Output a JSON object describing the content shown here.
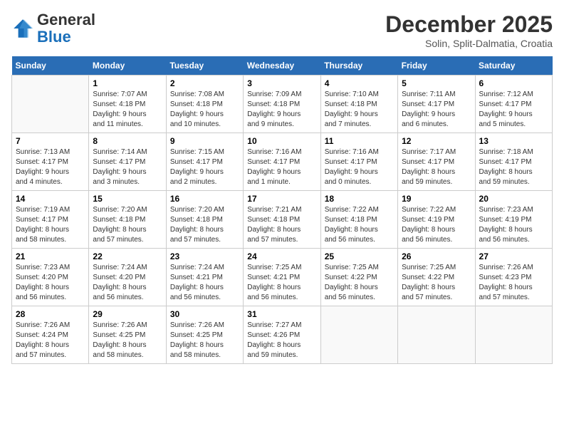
{
  "header": {
    "logo_general": "General",
    "logo_blue": "Blue",
    "title": "December 2025",
    "subtitle": "Solin, Split-Dalmatia, Croatia"
  },
  "days_of_week": [
    "Sunday",
    "Monday",
    "Tuesday",
    "Wednesday",
    "Thursday",
    "Friday",
    "Saturday"
  ],
  "weeks": [
    [
      {
        "day": "",
        "info": ""
      },
      {
        "day": "1",
        "info": "Sunrise: 7:07 AM\nSunset: 4:18 PM\nDaylight: 9 hours\nand 11 minutes."
      },
      {
        "day": "2",
        "info": "Sunrise: 7:08 AM\nSunset: 4:18 PM\nDaylight: 9 hours\nand 10 minutes."
      },
      {
        "day": "3",
        "info": "Sunrise: 7:09 AM\nSunset: 4:18 PM\nDaylight: 9 hours\nand 9 minutes."
      },
      {
        "day": "4",
        "info": "Sunrise: 7:10 AM\nSunset: 4:18 PM\nDaylight: 9 hours\nand 7 minutes."
      },
      {
        "day": "5",
        "info": "Sunrise: 7:11 AM\nSunset: 4:17 PM\nDaylight: 9 hours\nand 6 minutes."
      },
      {
        "day": "6",
        "info": "Sunrise: 7:12 AM\nSunset: 4:17 PM\nDaylight: 9 hours\nand 5 minutes."
      }
    ],
    [
      {
        "day": "7",
        "info": "Sunrise: 7:13 AM\nSunset: 4:17 PM\nDaylight: 9 hours\nand 4 minutes."
      },
      {
        "day": "8",
        "info": "Sunrise: 7:14 AM\nSunset: 4:17 PM\nDaylight: 9 hours\nand 3 minutes."
      },
      {
        "day": "9",
        "info": "Sunrise: 7:15 AM\nSunset: 4:17 PM\nDaylight: 9 hours\nand 2 minutes."
      },
      {
        "day": "10",
        "info": "Sunrise: 7:16 AM\nSunset: 4:17 PM\nDaylight: 9 hours\nand 1 minute."
      },
      {
        "day": "11",
        "info": "Sunrise: 7:16 AM\nSunset: 4:17 PM\nDaylight: 9 hours\nand 0 minutes."
      },
      {
        "day": "12",
        "info": "Sunrise: 7:17 AM\nSunset: 4:17 PM\nDaylight: 8 hours\nand 59 minutes."
      },
      {
        "day": "13",
        "info": "Sunrise: 7:18 AM\nSunset: 4:17 PM\nDaylight: 8 hours\nand 59 minutes."
      }
    ],
    [
      {
        "day": "14",
        "info": "Sunrise: 7:19 AM\nSunset: 4:17 PM\nDaylight: 8 hours\nand 58 minutes."
      },
      {
        "day": "15",
        "info": "Sunrise: 7:20 AM\nSunset: 4:18 PM\nDaylight: 8 hours\nand 57 minutes."
      },
      {
        "day": "16",
        "info": "Sunrise: 7:20 AM\nSunset: 4:18 PM\nDaylight: 8 hours\nand 57 minutes."
      },
      {
        "day": "17",
        "info": "Sunrise: 7:21 AM\nSunset: 4:18 PM\nDaylight: 8 hours\nand 57 minutes."
      },
      {
        "day": "18",
        "info": "Sunrise: 7:22 AM\nSunset: 4:18 PM\nDaylight: 8 hours\nand 56 minutes."
      },
      {
        "day": "19",
        "info": "Sunrise: 7:22 AM\nSunset: 4:19 PM\nDaylight: 8 hours\nand 56 minutes."
      },
      {
        "day": "20",
        "info": "Sunrise: 7:23 AM\nSunset: 4:19 PM\nDaylight: 8 hours\nand 56 minutes."
      }
    ],
    [
      {
        "day": "21",
        "info": "Sunrise: 7:23 AM\nSunset: 4:20 PM\nDaylight: 8 hours\nand 56 minutes."
      },
      {
        "day": "22",
        "info": "Sunrise: 7:24 AM\nSunset: 4:20 PM\nDaylight: 8 hours\nand 56 minutes."
      },
      {
        "day": "23",
        "info": "Sunrise: 7:24 AM\nSunset: 4:21 PM\nDaylight: 8 hours\nand 56 minutes."
      },
      {
        "day": "24",
        "info": "Sunrise: 7:25 AM\nSunset: 4:21 PM\nDaylight: 8 hours\nand 56 minutes."
      },
      {
        "day": "25",
        "info": "Sunrise: 7:25 AM\nSunset: 4:22 PM\nDaylight: 8 hours\nand 56 minutes."
      },
      {
        "day": "26",
        "info": "Sunrise: 7:25 AM\nSunset: 4:22 PM\nDaylight: 8 hours\nand 57 minutes."
      },
      {
        "day": "27",
        "info": "Sunrise: 7:26 AM\nSunset: 4:23 PM\nDaylight: 8 hours\nand 57 minutes."
      }
    ],
    [
      {
        "day": "28",
        "info": "Sunrise: 7:26 AM\nSunset: 4:24 PM\nDaylight: 8 hours\nand 57 minutes."
      },
      {
        "day": "29",
        "info": "Sunrise: 7:26 AM\nSunset: 4:25 PM\nDaylight: 8 hours\nand 58 minutes."
      },
      {
        "day": "30",
        "info": "Sunrise: 7:26 AM\nSunset: 4:25 PM\nDaylight: 8 hours\nand 58 minutes."
      },
      {
        "day": "31",
        "info": "Sunrise: 7:27 AM\nSunset: 4:26 PM\nDaylight: 8 hours\nand 59 minutes."
      },
      {
        "day": "",
        "info": ""
      },
      {
        "day": "",
        "info": ""
      },
      {
        "day": "",
        "info": ""
      }
    ]
  ]
}
